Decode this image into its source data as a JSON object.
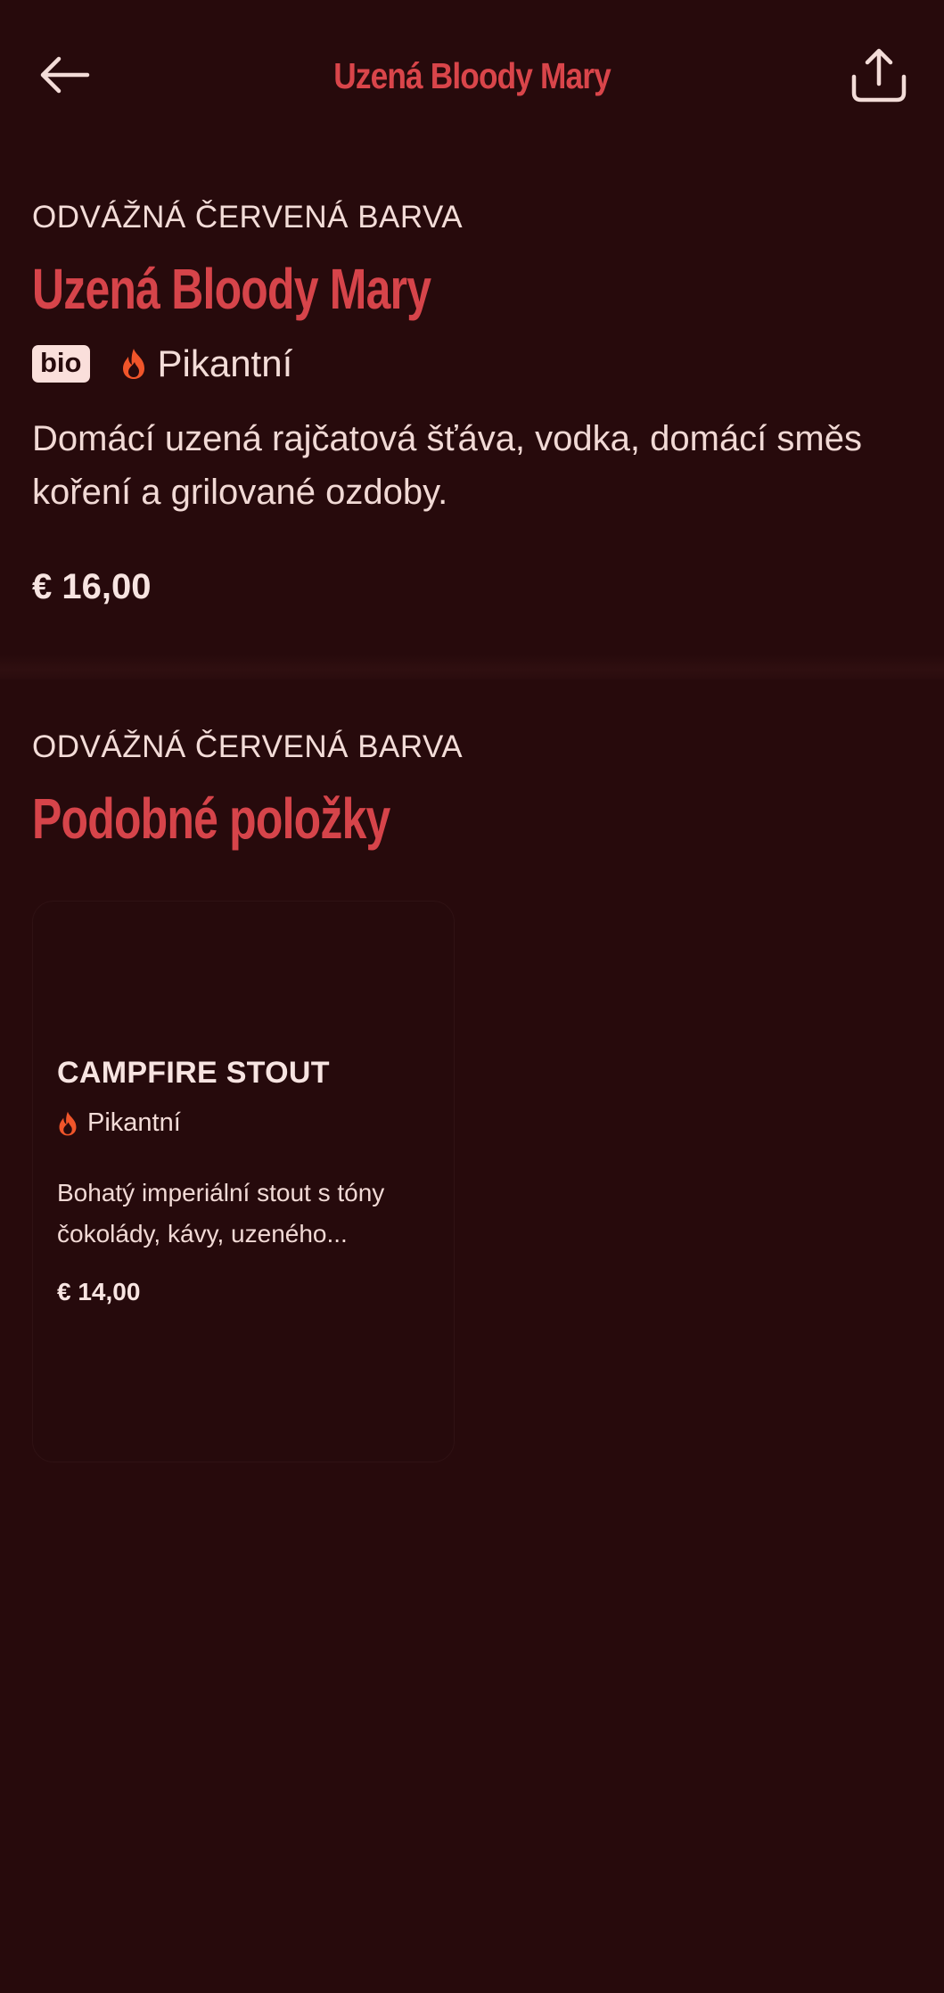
{
  "header": {
    "title": "Uzená Bloody Mary",
    "back_icon": "arrow-left-icon",
    "share_icon": "share-icon"
  },
  "item": {
    "category": "ODVÁŽNÁ ČERVENÁ BARVA",
    "name": "Uzená Bloody Mary",
    "badge": "bio",
    "tag": "Pikantní",
    "tag_icon": "flame-icon",
    "description": "Domácí uzená rajčatová šťáva, vodka, domácí směs koření a grilované ozdoby.",
    "price": "€ 16,00"
  },
  "similar": {
    "category": "ODVÁŽNÁ ČERVENÁ BARVA",
    "title": "Podobné položky",
    "items": [
      {
        "name": "CAMPFIRE STOUT",
        "tag": "Pikantní",
        "tag_icon": "flame-icon",
        "description": "Bohatý imperiální stout s tóny čokolády, kávy, uzeného...",
        "price": "€ 14,00"
      }
    ]
  },
  "colors": {
    "background": "#270a0c",
    "accent": "#d6444a",
    "text": "#f7e4e1",
    "flame": "#f0552a",
    "badge_bg": "#fadfdb"
  }
}
